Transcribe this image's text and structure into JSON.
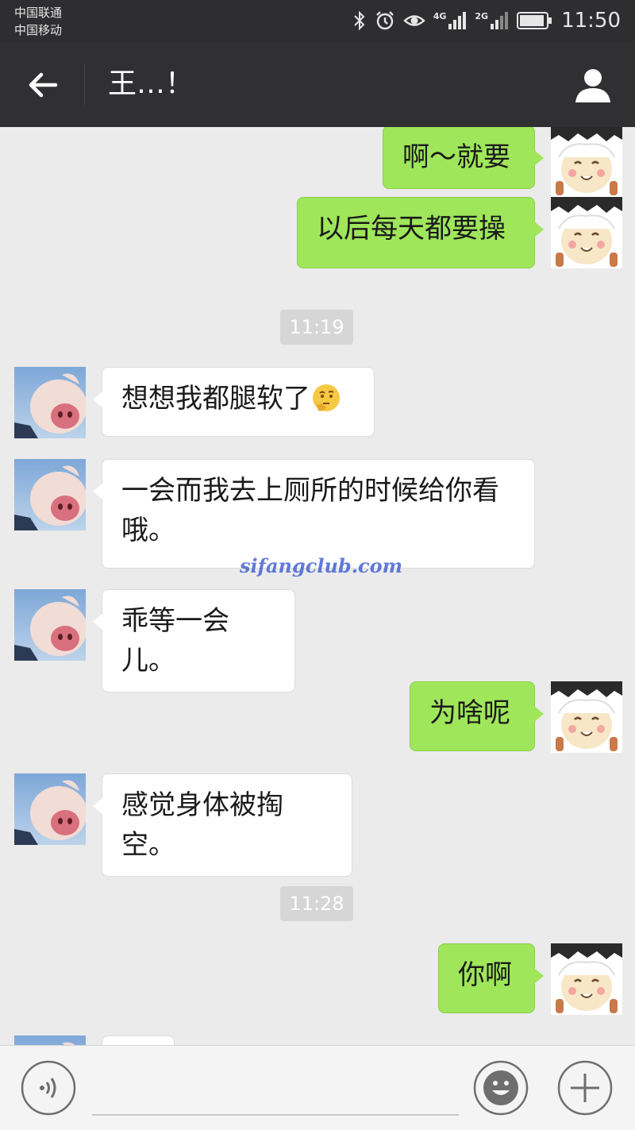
{
  "status_bar": {
    "carrier_1": "中国联通",
    "carrier_2": "中国移动",
    "network_1": "4G",
    "network_2": "2G",
    "time": "11:50"
  },
  "nav": {
    "title": "王…！"
  },
  "messages": [
    {
      "type": "msg",
      "side": "me",
      "text": "啊～就要",
      "avatar": "sheep-avatar"
    },
    {
      "type": "msg",
      "side": "me",
      "text": "以后每天都要操",
      "avatar": "sheep-avatar"
    },
    {
      "type": "time",
      "text": "11:19"
    },
    {
      "type": "msg",
      "side": "other",
      "text": "想想我都腿软了",
      "emoji": "thinking-emoji",
      "avatar": "pig-avatar"
    },
    {
      "type": "msg",
      "side": "other",
      "text": "一会而我去上厕所的时候给你看哦。",
      "avatar": "pig-avatar"
    },
    {
      "type": "msg",
      "side": "other",
      "text": "乖等一会儿。",
      "avatar": "pig-avatar"
    },
    {
      "type": "msg",
      "side": "me",
      "text": "为啥呢",
      "avatar": "sheep-avatar"
    },
    {
      "type": "msg",
      "side": "other",
      "text": "感觉身体被掏空。",
      "avatar": "pig-avatar"
    },
    {
      "type": "time",
      "text": "11:28"
    },
    {
      "type": "msg",
      "side": "me",
      "text": "你啊",
      "avatar": "sheep-avatar"
    }
  ],
  "watermark": "sifangclub.com",
  "input_bar": {
    "icons": [
      "voice-icon",
      "emoji-icon",
      "plus-icon"
    ]
  },
  "colors": {
    "my_bubble": "#9fe65a",
    "other_bubble": "#ffffff",
    "background": "#ebebeb",
    "nav_bar": "#303033"
  }
}
